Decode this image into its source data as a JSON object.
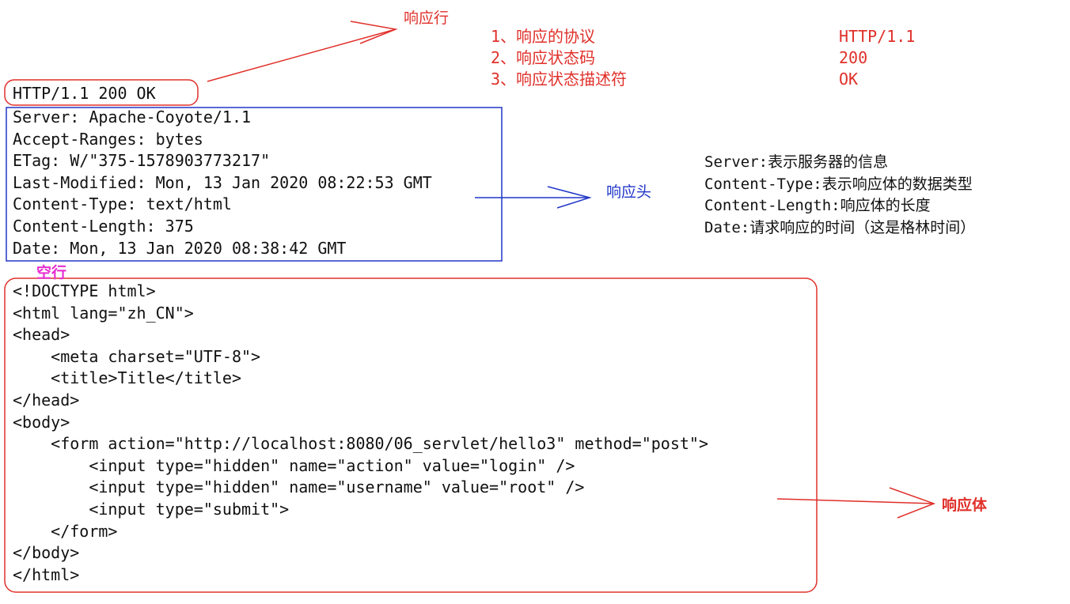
{
  "labels": {
    "response_line": "响应行",
    "response_header": "响应头",
    "empty_line": "空行",
    "response_body": "响应体"
  },
  "status_line": "HTTP/1.1 200 OK",
  "status_notes": {
    "items": [
      {
        "label": "1、响应的协议",
        "value": "HTTP/1.1"
      },
      {
        "label": "2、响应状态码",
        "value": "200"
      },
      {
        "label": "3、响应状态描述符",
        "value": "OK"
      }
    ]
  },
  "headers": [
    "Server: Apache-Coyote/1.1",
    "Accept-Ranges: bytes",
    "ETag: W/\"375-1578903773217\"",
    "Last-Modified: Mon, 13 Jan 2020 08:22:53 GMT",
    "Content-Type: text/html",
    "Content-Length: 375",
    "Date: Mon, 13 Jan 2020 08:38:42 GMT"
  ],
  "header_notes": [
    "Server:表示服务器的信息",
    "Content-Type:表示响应体的数据类型",
    "Content-Length:响应体的长度",
    "Date:请求响应的时间（这是格林时间）"
  ],
  "body_lines": [
    "<!DOCTYPE html>",
    "<html lang=\"zh_CN\">",
    "<head>",
    "    <meta charset=\"UTF-8\">",
    "    <title>Title</title>",
    "</head>",
    "<body>",
    "    <form action=\"http://localhost:8080/06_servlet/hello3\" method=\"post\">",
    "        <input type=\"hidden\" name=\"action\" value=\"login\" />",
    "        <input type=\"hidden\" name=\"username\" value=\"root\" />",
    "        <input type=\"submit\">",
    "    </form>",
    "</body>",
    "</html>"
  ],
  "colors": {
    "red": "#e0302a",
    "blue": "#2036c8",
    "pink": "#e62ed0"
  }
}
